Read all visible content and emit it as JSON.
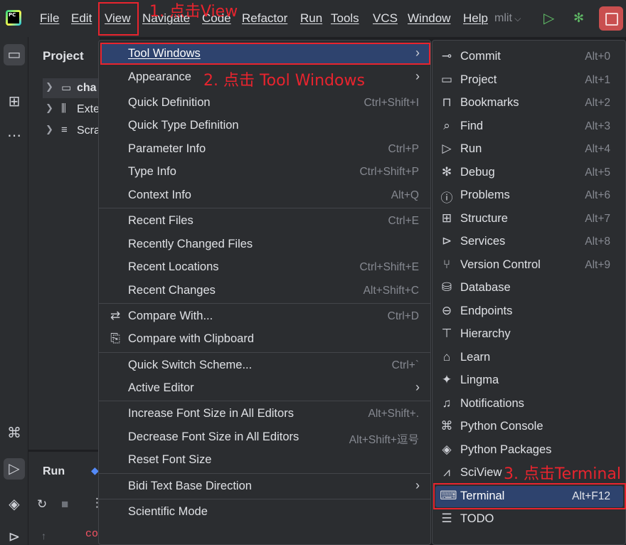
{
  "menubar": {
    "items": [
      "File",
      "Edit",
      "View",
      "Navigate",
      "Code",
      "Refactor",
      "Run",
      "Tools",
      "VCS",
      "Window",
      "Help"
    ],
    "project_switcher": "mlit"
  },
  "project_panel": {
    "title": "Project",
    "tree": [
      {
        "label": "cha",
        "icon": "folder-icon"
      },
      {
        "label": "Exte",
        "icon": "external-libraries-icon"
      },
      {
        "label": "Scra",
        "icon": "scratches-icon"
      }
    ]
  },
  "run_panel": {
    "title": "Run",
    "console_text": "command:"
  },
  "view_menu": {
    "items": [
      {
        "label": "Tool Windows",
        "shortcut": "",
        "submenu": true
      },
      {
        "label": "Appearance",
        "shortcut": "",
        "submenu": true
      },
      {
        "label": "Quick Definition",
        "shortcut": "Ctrl+Shift+I"
      },
      {
        "label": "Quick Type Definition",
        "shortcut": ""
      },
      {
        "label": "Parameter Info",
        "shortcut": "Ctrl+P"
      },
      {
        "label": "Type Info",
        "shortcut": "Ctrl+Shift+P"
      },
      {
        "label": "Context Info",
        "shortcut": "Alt+Q"
      },
      {
        "label": "Recent Files",
        "shortcut": "Ctrl+E"
      },
      {
        "label": "Recently Changed Files",
        "shortcut": ""
      },
      {
        "label": "Recent Locations",
        "shortcut": "Ctrl+Shift+E"
      },
      {
        "label": "Recent Changes",
        "shortcut": "Alt+Shift+C"
      },
      {
        "label": "Compare With...",
        "shortcut": "Ctrl+D"
      },
      {
        "label": "Compare with Clipboard",
        "shortcut": ""
      },
      {
        "label": "Quick Switch Scheme...",
        "shortcut": "Ctrl+`"
      },
      {
        "label": "Active Editor",
        "shortcut": "",
        "submenu": true
      },
      {
        "label": "Increase Font Size in All Editors",
        "shortcut": "Alt+Shift+."
      },
      {
        "label": "Decrease Font Size in All Editors",
        "shortcut": "Alt+Shift+逗号"
      },
      {
        "label": "Reset Font Size",
        "shortcut": ""
      },
      {
        "label": "Bidi Text Base Direction",
        "shortcut": "",
        "submenu": true
      },
      {
        "label": "Scientific Mode",
        "shortcut": ""
      }
    ]
  },
  "tool_windows_menu": {
    "items": [
      {
        "label": "Commit",
        "shortcut": "Alt+0"
      },
      {
        "label": "Project",
        "shortcut": "Alt+1"
      },
      {
        "label": "Bookmarks",
        "shortcut": "Alt+2"
      },
      {
        "label": "Find",
        "shortcut": "Alt+3"
      },
      {
        "label": "Run",
        "shortcut": "Alt+4"
      },
      {
        "label": "Debug",
        "shortcut": "Alt+5"
      },
      {
        "label": "Problems",
        "shortcut": "Alt+6"
      },
      {
        "label": "Structure",
        "shortcut": "Alt+7"
      },
      {
        "label": "Services",
        "shortcut": "Alt+8"
      },
      {
        "label": "Version Control",
        "shortcut": "Alt+9"
      },
      {
        "label": "Database",
        "shortcut": ""
      },
      {
        "label": "Endpoints",
        "shortcut": ""
      },
      {
        "label": "Hierarchy",
        "shortcut": ""
      },
      {
        "label": "Learn",
        "shortcut": ""
      },
      {
        "label": "Lingma",
        "shortcut": ""
      },
      {
        "label": "Notifications",
        "shortcut": ""
      },
      {
        "label": "Python Console",
        "shortcut": ""
      },
      {
        "label": "Python Packages",
        "shortcut": ""
      },
      {
        "label": "SciView",
        "shortcut": ""
      },
      {
        "label": "Terminal",
        "shortcut": "Alt+F12"
      },
      {
        "label": "TODO",
        "shortcut": ""
      }
    ]
  },
  "annotations": {
    "step1": "1. 点击View",
    "step2": "2. 点击 Tool Windows",
    "step3": "3. 点击Terminal"
  },
  "colors": {
    "accent_highlight": "#2e436e",
    "annotation_red": "#e8242e",
    "run_green": "#5fb865",
    "stop_red": "#c94f4f"
  }
}
